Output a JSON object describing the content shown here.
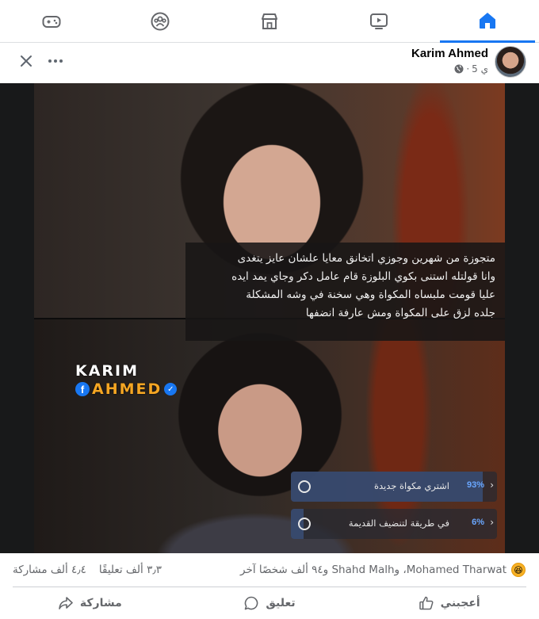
{
  "nav": {
    "tabs": [
      {
        "id": "home",
        "icon": "home-icon",
        "active": true
      },
      {
        "id": "watch",
        "icon": "video-icon",
        "active": false
      },
      {
        "id": "marketplace",
        "icon": "store-icon",
        "active": false
      },
      {
        "id": "groups",
        "icon": "groups-icon",
        "active": false
      },
      {
        "id": "gaming",
        "icon": "gamepad-icon",
        "active": false
      }
    ],
    "accent_color": "#1877f2"
  },
  "post": {
    "author": "Karim Ahmed",
    "time": "5 ي",
    "separator": "·",
    "privacy_icon": "globe-icon",
    "caption_lines": [
      "متجوزة من شهرين وجوزي اتخانق معايا علشان عايز يتغدى",
      "وانا قولتله استنى بكوي البلوزة قام عامل دكر وجاي يمد ايده",
      "عليا قومت ملبساه المكواة وهي سخنة في وشه المشكلة",
      "جلده لزق على المكواة ومش عارفة انضفها"
    ],
    "watermark": {
      "line1": "KARIM",
      "line2": "AHMED",
      "fb_glyph": "f",
      "check_glyph": "✓"
    },
    "poll": [
      {
        "text": "اشتري مكواة جديدة",
        "percent": "93%",
        "fraction": 0.93
      },
      {
        "text": "في طريقة لتنضيف القديمة",
        "percent": "6%",
        "fraction": 0.06
      }
    ]
  },
  "reactions": {
    "emoji": "😆",
    "names": "Mohamed Tharwat، وShahd Malh و٩٤ ألف شخصًا آخر",
    "comments": "٣٫٣ ألف تعليقًا",
    "shares": "٤٫٤ ألف مشاركة"
  },
  "actions": {
    "like": "أعجبني",
    "comment": "تعليق",
    "share": "مشاركة"
  }
}
